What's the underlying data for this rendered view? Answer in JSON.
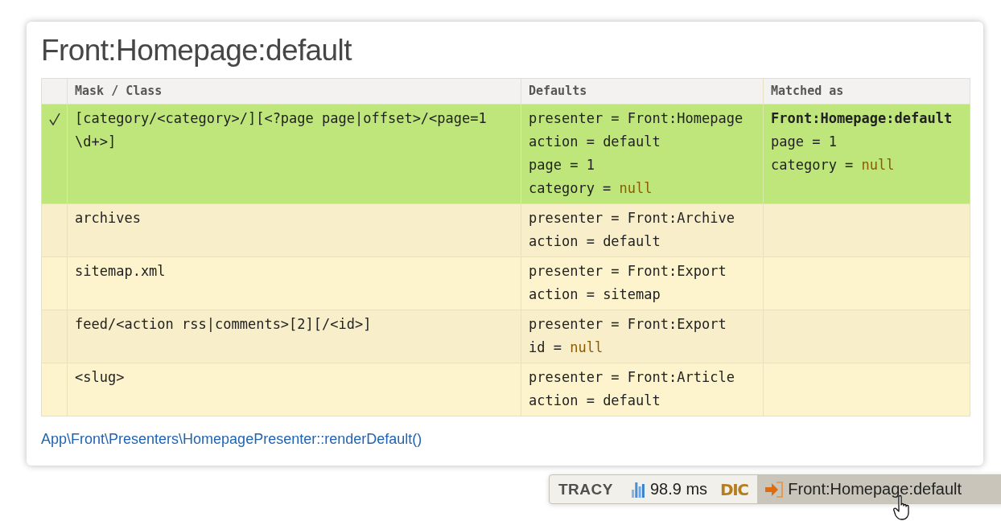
{
  "panel": {
    "title": "Front:Homepage:default",
    "link": "App\\Front\\Presenters\\HomepagePresenter::renderDefault()"
  },
  "table": {
    "columns": [
      "Mask / Class",
      "Defaults",
      "Matched as"
    ],
    "rows": [
      {
        "matched": true,
        "mask": "[category/<category>/][<?page page|offset>/<page=1 \\d+>]",
        "defaults": [
          {
            "key": "presenter",
            "op": "=",
            "value": "Front:Homepage",
            "kind": "text"
          },
          {
            "key": "action",
            "op": "=",
            "value": "default",
            "kind": "text"
          },
          {
            "key": "page",
            "op": "=",
            "value": "1",
            "kind": "text"
          },
          {
            "key": "category",
            "op": "=",
            "value": "null",
            "kind": "null"
          }
        ],
        "matched_as": {
          "destination": "Front:Homepage:default",
          "params": [
            {
              "key": "page",
              "op": "=",
              "value": "1",
              "kind": "text"
            },
            {
              "key": "category",
              "op": "=",
              "value": "null",
              "kind": "null"
            }
          ]
        }
      },
      {
        "matched": false,
        "mask": "archives",
        "defaults": [
          {
            "key": "presenter",
            "op": "=",
            "value": "Front:Archive",
            "kind": "text"
          },
          {
            "key": "action",
            "op": "=",
            "value": "default",
            "kind": "text"
          }
        ]
      },
      {
        "matched": false,
        "mask": "sitemap.xml",
        "defaults": [
          {
            "key": "presenter",
            "op": "=",
            "value": "Front:Export",
            "kind": "text"
          },
          {
            "key": "action",
            "op": "=",
            "value": "sitemap",
            "kind": "text"
          }
        ]
      },
      {
        "matched": false,
        "mask": "feed/<action rss|comments>[2][/<id>]",
        "defaults": [
          {
            "key": "presenter",
            "op": "=",
            "value": "Front:Export",
            "kind": "text"
          },
          {
            "key": "id",
            "op": "=",
            "value": "null",
            "kind": "null"
          }
        ]
      },
      {
        "matched": false,
        "mask": "<slug>",
        "defaults": [
          {
            "key": "presenter",
            "op": "=",
            "value": "Front:Article",
            "kind": "text"
          },
          {
            "key": "action",
            "op": "=",
            "value": "default",
            "kind": "text"
          }
        ]
      }
    ]
  },
  "tracy_bar": {
    "logo": "TRACY",
    "panels": [
      {
        "kind": "time",
        "label": "98.9 ms",
        "selected": false
      },
      {
        "kind": "dic",
        "label": "DIC",
        "selected": false
      },
      {
        "kind": "route",
        "label": "Front:Homepage:default",
        "selected": true
      }
    ]
  }
}
